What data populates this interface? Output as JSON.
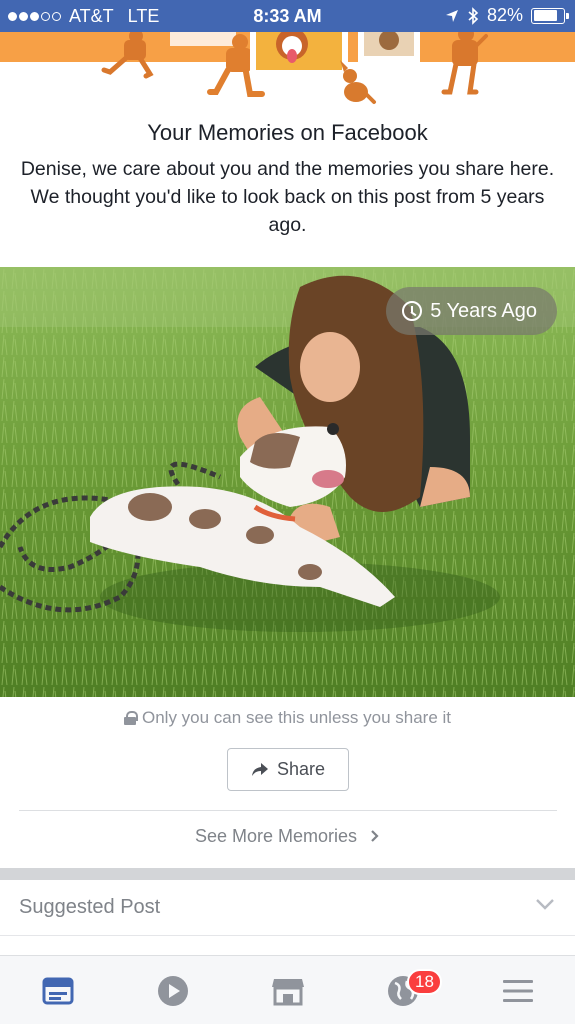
{
  "status_bar": {
    "carrier": "AT&T",
    "network": "LTE",
    "time": "8:33 AM",
    "battery_percent": "82%",
    "battery_level": 0.82,
    "signal_bars_filled": 3,
    "signal_bars_total": 5
  },
  "memory": {
    "title": "Your Memories on Facebook",
    "intro": "Denise, we care about you and the memories you share here. We thought you'd like to look back on this post from 5 years ago.",
    "badge_text": "5 Years Ago",
    "privacy_text": "Only you can see this unless you share it",
    "share_label": "Share",
    "see_more_label": "See More Memories"
  },
  "suggested": {
    "label": "Suggested Post"
  },
  "tabbar": {
    "notifications_count": "18"
  },
  "colors": {
    "brand_blue": "#4267b2",
    "banner_orange": "#f7a046",
    "badge_red": "#fa3e3e"
  }
}
